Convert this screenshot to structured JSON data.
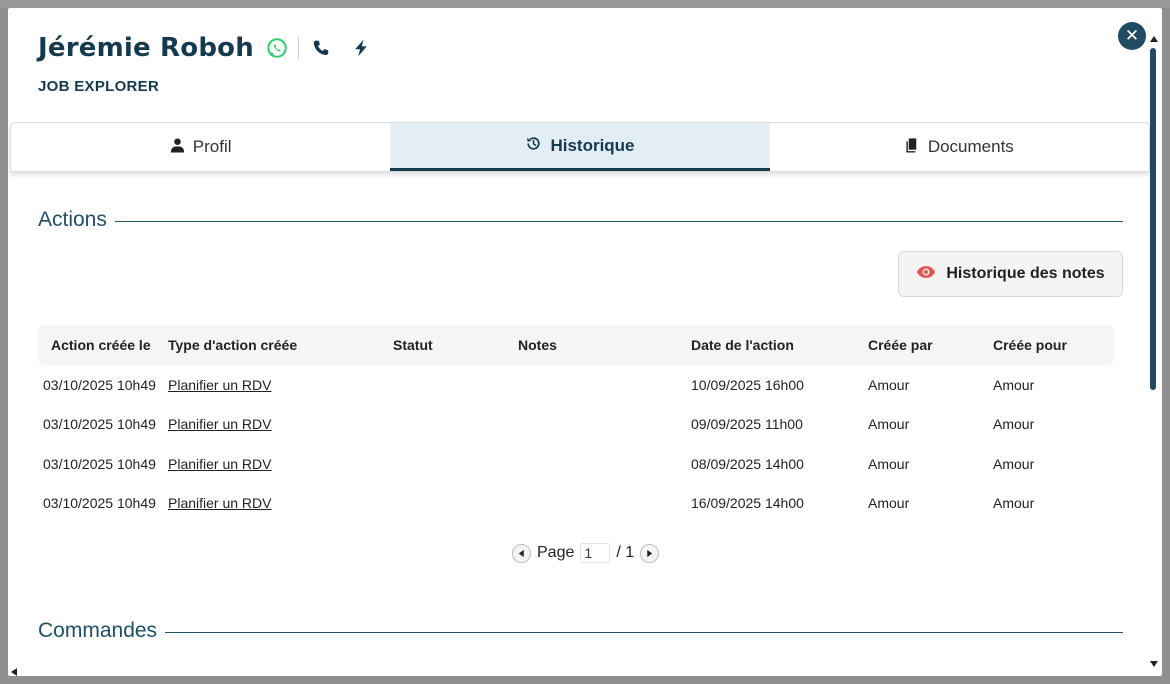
{
  "candidate": {
    "name": "Jérémie Roboh",
    "company": "JOB EXPLORER"
  },
  "tabs": [
    {
      "label": "Profil",
      "icon": "user-icon",
      "active": false
    },
    {
      "label": "Historique",
      "icon": "history-icon",
      "active": true
    },
    {
      "label": "Documents",
      "icon": "documents-icon",
      "active": false
    }
  ],
  "actions": {
    "title": "Actions",
    "notes_button": "Historique des notes",
    "columns": [
      "Action créée le",
      "Type d'action créée",
      "Statut",
      "Notes",
      "Date de l'action",
      "Créée par",
      "Créée pour"
    ],
    "rows": [
      {
        "created": "03/10/2025 10h49",
        "type": "Planifier un RDV",
        "status": "",
        "notes": "",
        "date": "10/09/2025 16h00",
        "by": "Amour",
        "for": "Amour"
      },
      {
        "created": "03/10/2025 10h49",
        "type": "Planifier un RDV",
        "status": "",
        "notes": "",
        "date": "09/09/2025 11h00",
        "by": "Amour",
        "for": "Amour"
      },
      {
        "created": "03/10/2025 10h49",
        "type": "Planifier un RDV",
        "status": "",
        "notes": "",
        "date": "08/09/2025 14h00",
        "by": "Amour",
        "for": "Amour"
      },
      {
        "created": "03/10/2025 10h49",
        "type": "Planifier un RDV",
        "status": "",
        "notes": "",
        "date": "16/09/2025 14h00",
        "by": "Amour",
        "for": "Amour"
      }
    ],
    "pager": {
      "label": "Page",
      "current": "1",
      "total": "/ 1"
    }
  },
  "commandes": {
    "title": "Commandes"
  },
  "colors": {
    "primary": "#143a4f",
    "accent": "#1f5068",
    "whatsapp": "#25d366",
    "eye": "#e0564f"
  }
}
